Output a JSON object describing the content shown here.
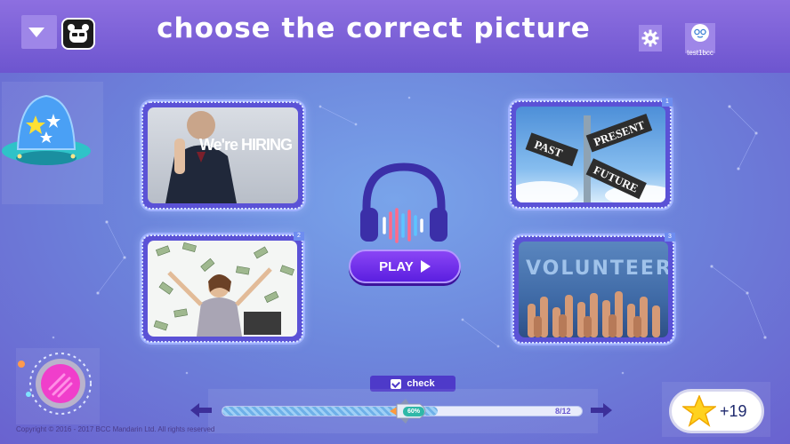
{
  "header": {
    "title": "choose the  correct picture",
    "menu_icon": "triangle-down-icon",
    "logo_icon": "panda-app-icon",
    "settings_icon": "gear-icon",
    "username": "test1bcc"
  },
  "cards": [
    {
      "number": "",
      "scene": "We're HIRING",
      "image": "business-hiring-photo"
    },
    {
      "number": "1",
      "scene": "PAST PRESENT FUTURE",
      "image": "signpost-photo"
    },
    {
      "number": "2",
      "scene": "",
      "image": "money-rain-photo"
    },
    {
      "number": "3",
      "scene": "VOLUNTEER",
      "image": "volunteer-hands-photo"
    }
  ],
  "player": {
    "play_label": "PLAY",
    "headphones_icon": "headphones-icon"
  },
  "footer": {
    "check_label": "check",
    "progress_percent": 60,
    "progress_label": "60%",
    "count_label": "8/12",
    "copyright": "Copyright © 2016 - 2017 BCC Mandarin Ltd. All rights reserved",
    "score": "+19"
  },
  "colors": {
    "accent": "#6a33e8",
    "topbar": "#7a60d8",
    "card_border": "#5b52d6"
  }
}
